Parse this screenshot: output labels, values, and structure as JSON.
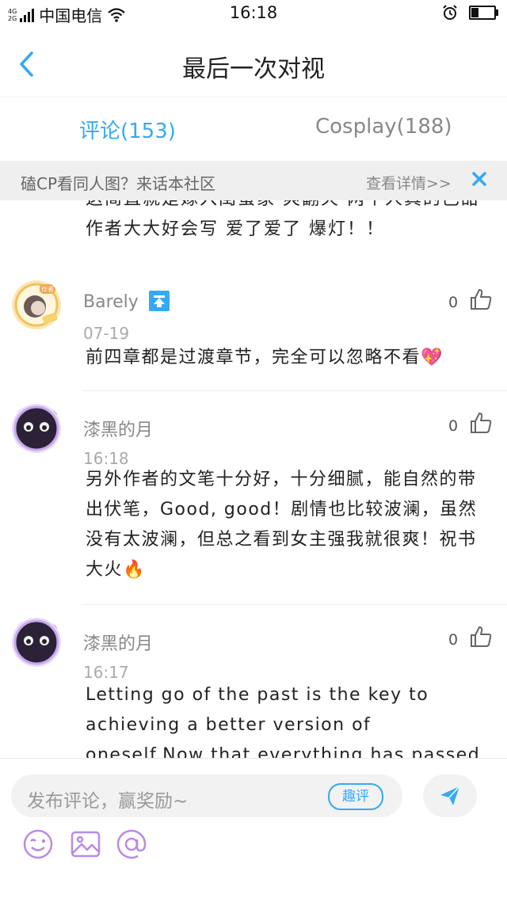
{
  "status": {
    "network_top": "4G",
    "network_bottom": "2G",
    "carrier": "中国电信",
    "time": "16:18"
  },
  "nav": {
    "title": "最后一次对视"
  },
  "tabs": [
    {
      "label": "评论(153)"
    },
    {
      "label": "Cosplay(188)"
    }
  ],
  "banner": {
    "text": "磕CP看同人图？来话本社区",
    "link": "查看详情>>"
  },
  "prev_comment_text": "这简直就是嫁入闺蜜家 爽翻天 两个人真的巴甜 作者大大好会写 爱了爱了 爆灯！！",
  "comments": [
    {
      "user": "Barely",
      "time": "07-19",
      "likes": "0",
      "text": "前四章都是过渡章节，完全可以忽略不看💖",
      "avatar_badge": "作者"
    },
    {
      "user": "漆黑的月",
      "time": "16:18",
      "likes": "0",
      "text": "另外作者的文笔十分好，十分细腻，能自然的带出伏笔，Good, good！剧情也比较波澜，虽然没有太波澜，但总之看到女主强我就很爽！祝书大火🔥"
    },
    {
      "user": "漆黑的月",
      "time": "16:17",
      "likes": "0",
      "text": "Letting go of the past is the key to achieving a better version of oneself.Now that everything has passed, please"
    }
  ],
  "composer": {
    "placeholder": "发布评论，赢奖励~",
    "tag_label": "趣评"
  },
  "colors": {
    "accent": "#35a9f4",
    "tool_purple": "#b98ae6"
  }
}
